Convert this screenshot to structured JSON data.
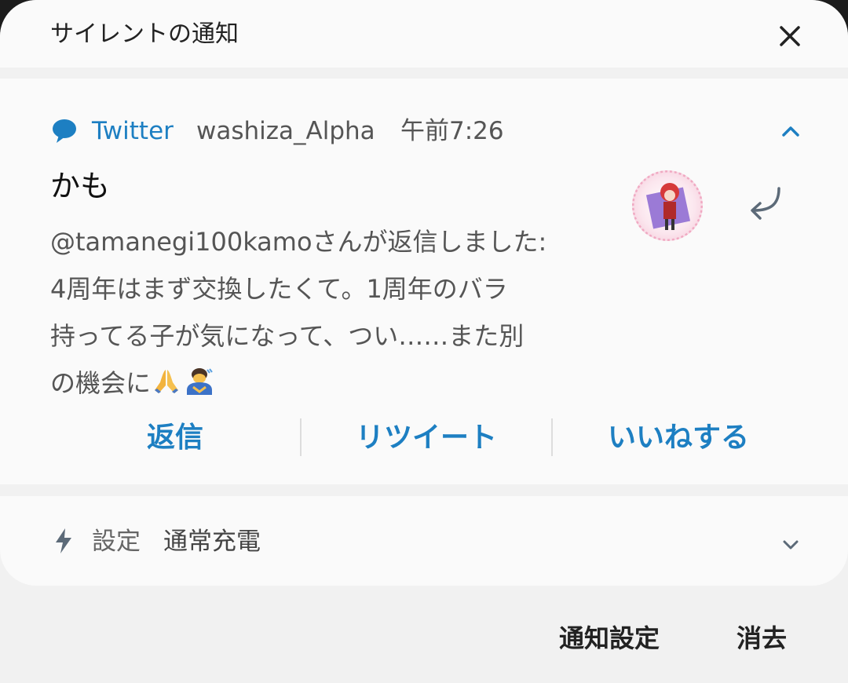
{
  "header": {
    "title": "サイレントの通知"
  },
  "notification": {
    "app_name": "Twitter",
    "sender": "washiza_Alpha",
    "time": "午前7:26",
    "title": "かも",
    "body": "@tamanegi100kamoさんが返信しました:\n4周年はまず交換したくて。1周年のバラ\n持ってる子が気になって、つい……また別\nの機会に",
    "body_emojis": [
      "folded-hands",
      "person-bowing"
    ],
    "actions": [
      "返信",
      "リツイート",
      "いいねする"
    ],
    "accent_color": "#1d7fc2"
  },
  "system": {
    "label": "設定",
    "status": "通常充電"
  },
  "footer": {
    "settings": "通知設定",
    "clear": "消去"
  }
}
